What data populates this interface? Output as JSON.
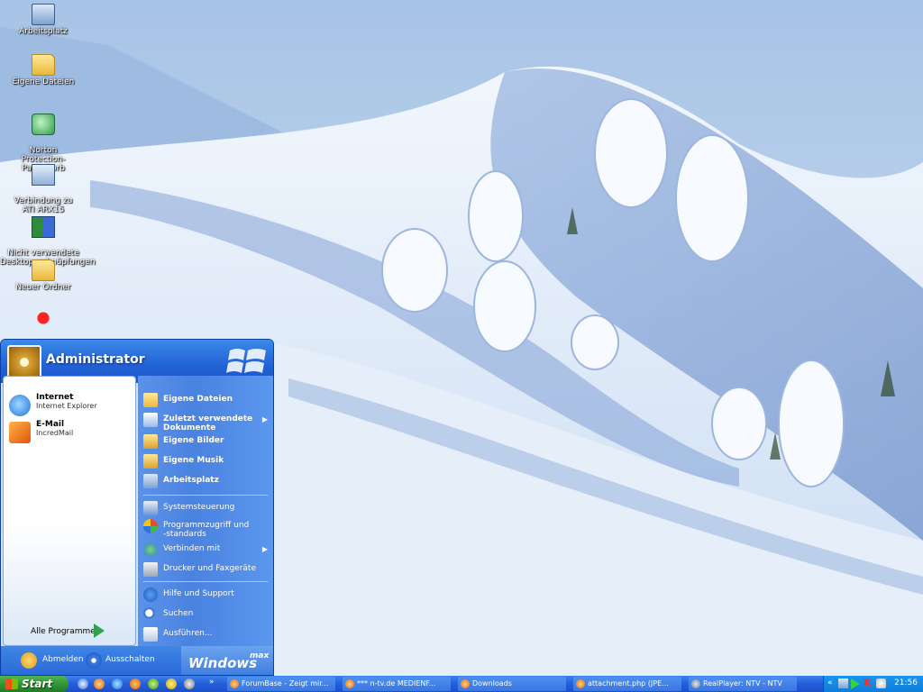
{
  "desktop": {
    "icons": [
      {
        "label": "Arbeitsplatz",
        "icon": "my-computer-icon"
      },
      {
        "label": "Eigene Dateien",
        "icon": "my-documents-folder-icon"
      },
      {
        "label": "Norton\nProtection-Papierkorb",
        "icon": "recycle-bin-icon"
      },
      {
        "label": "Verbindung zu\nATI ARX15",
        "icon": "network-shortcut-icon"
      },
      {
        "label": "Nicht verwendete\nDesktopverknüpfungen",
        "icon": "desktop-cleanup-icon"
      },
      {
        "label": "Neuer Ordner",
        "icon": "folder-icon"
      }
    ]
  },
  "start_menu": {
    "username": "Administrator",
    "pinned": [
      {
        "title": "Internet",
        "subtitle": "Internet Explorer",
        "icon": "internet-explorer-icon"
      },
      {
        "title": "E-Mail",
        "subtitle": "IncredMail",
        "icon": "email-icon"
      }
    ],
    "all_programs": "Alle Programme",
    "right_items": [
      {
        "label": "Eigene Dateien",
        "bold": true,
        "arrow": false
      },
      {
        "label": "Zuletzt verwendete Dokumente",
        "bold": true,
        "arrow": true
      },
      {
        "label": "Eigene Bilder",
        "bold": true,
        "arrow": false
      },
      {
        "label": "Eigene Musik",
        "bold": true,
        "arrow": false
      },
      {
        "label": "Arbeitsplatz",
        "bold": true,
        "arrow": false
      },
      {
        "label": "Systemsteuerung",
        "bold": false,
        "arrow": false
      },
      {
        "label": "Programmzugriff und -standards",
        "bold": false,
        "arrow": false
      },
      {
        "label": "Verbinden mit",
        "bold": false,
        "arrow": true
      },
      {
        "label": "Drucker und Faxgeräte",
        "bold": false,
        "arrow": false
      },
      {
        "label": "Hilfe und Support",
        "bold": false,
        "arrow": false
      },
      {
        "label": "Suchen",
        "bold": false,
        "arrow": false
      },
      {
        "label": "Ausführen...",
        "bold": false,
        "arrow": false
      }
    ],
    "logoff": "Abmelden",
    "shutdown": "Ausschalten",
    "brand": "Windows",
    "brand_suffix": "max"
  },
  "taskbar": {
    "start_label": "Start",
    "tasks": [
      {
        "label": "ForumBase - Zeigt mir..."
      },
      {
        "label": "*** n-tv.de MEDIENF..."
      },
      {
        "label": "Downloads"
      },
      {
        "label": "attachment.php (JPE..."
      },
      {
        "label": "RealPlayer: NTV - NTV"
      }
    ],
    "clock": "21:56"
  }
}
